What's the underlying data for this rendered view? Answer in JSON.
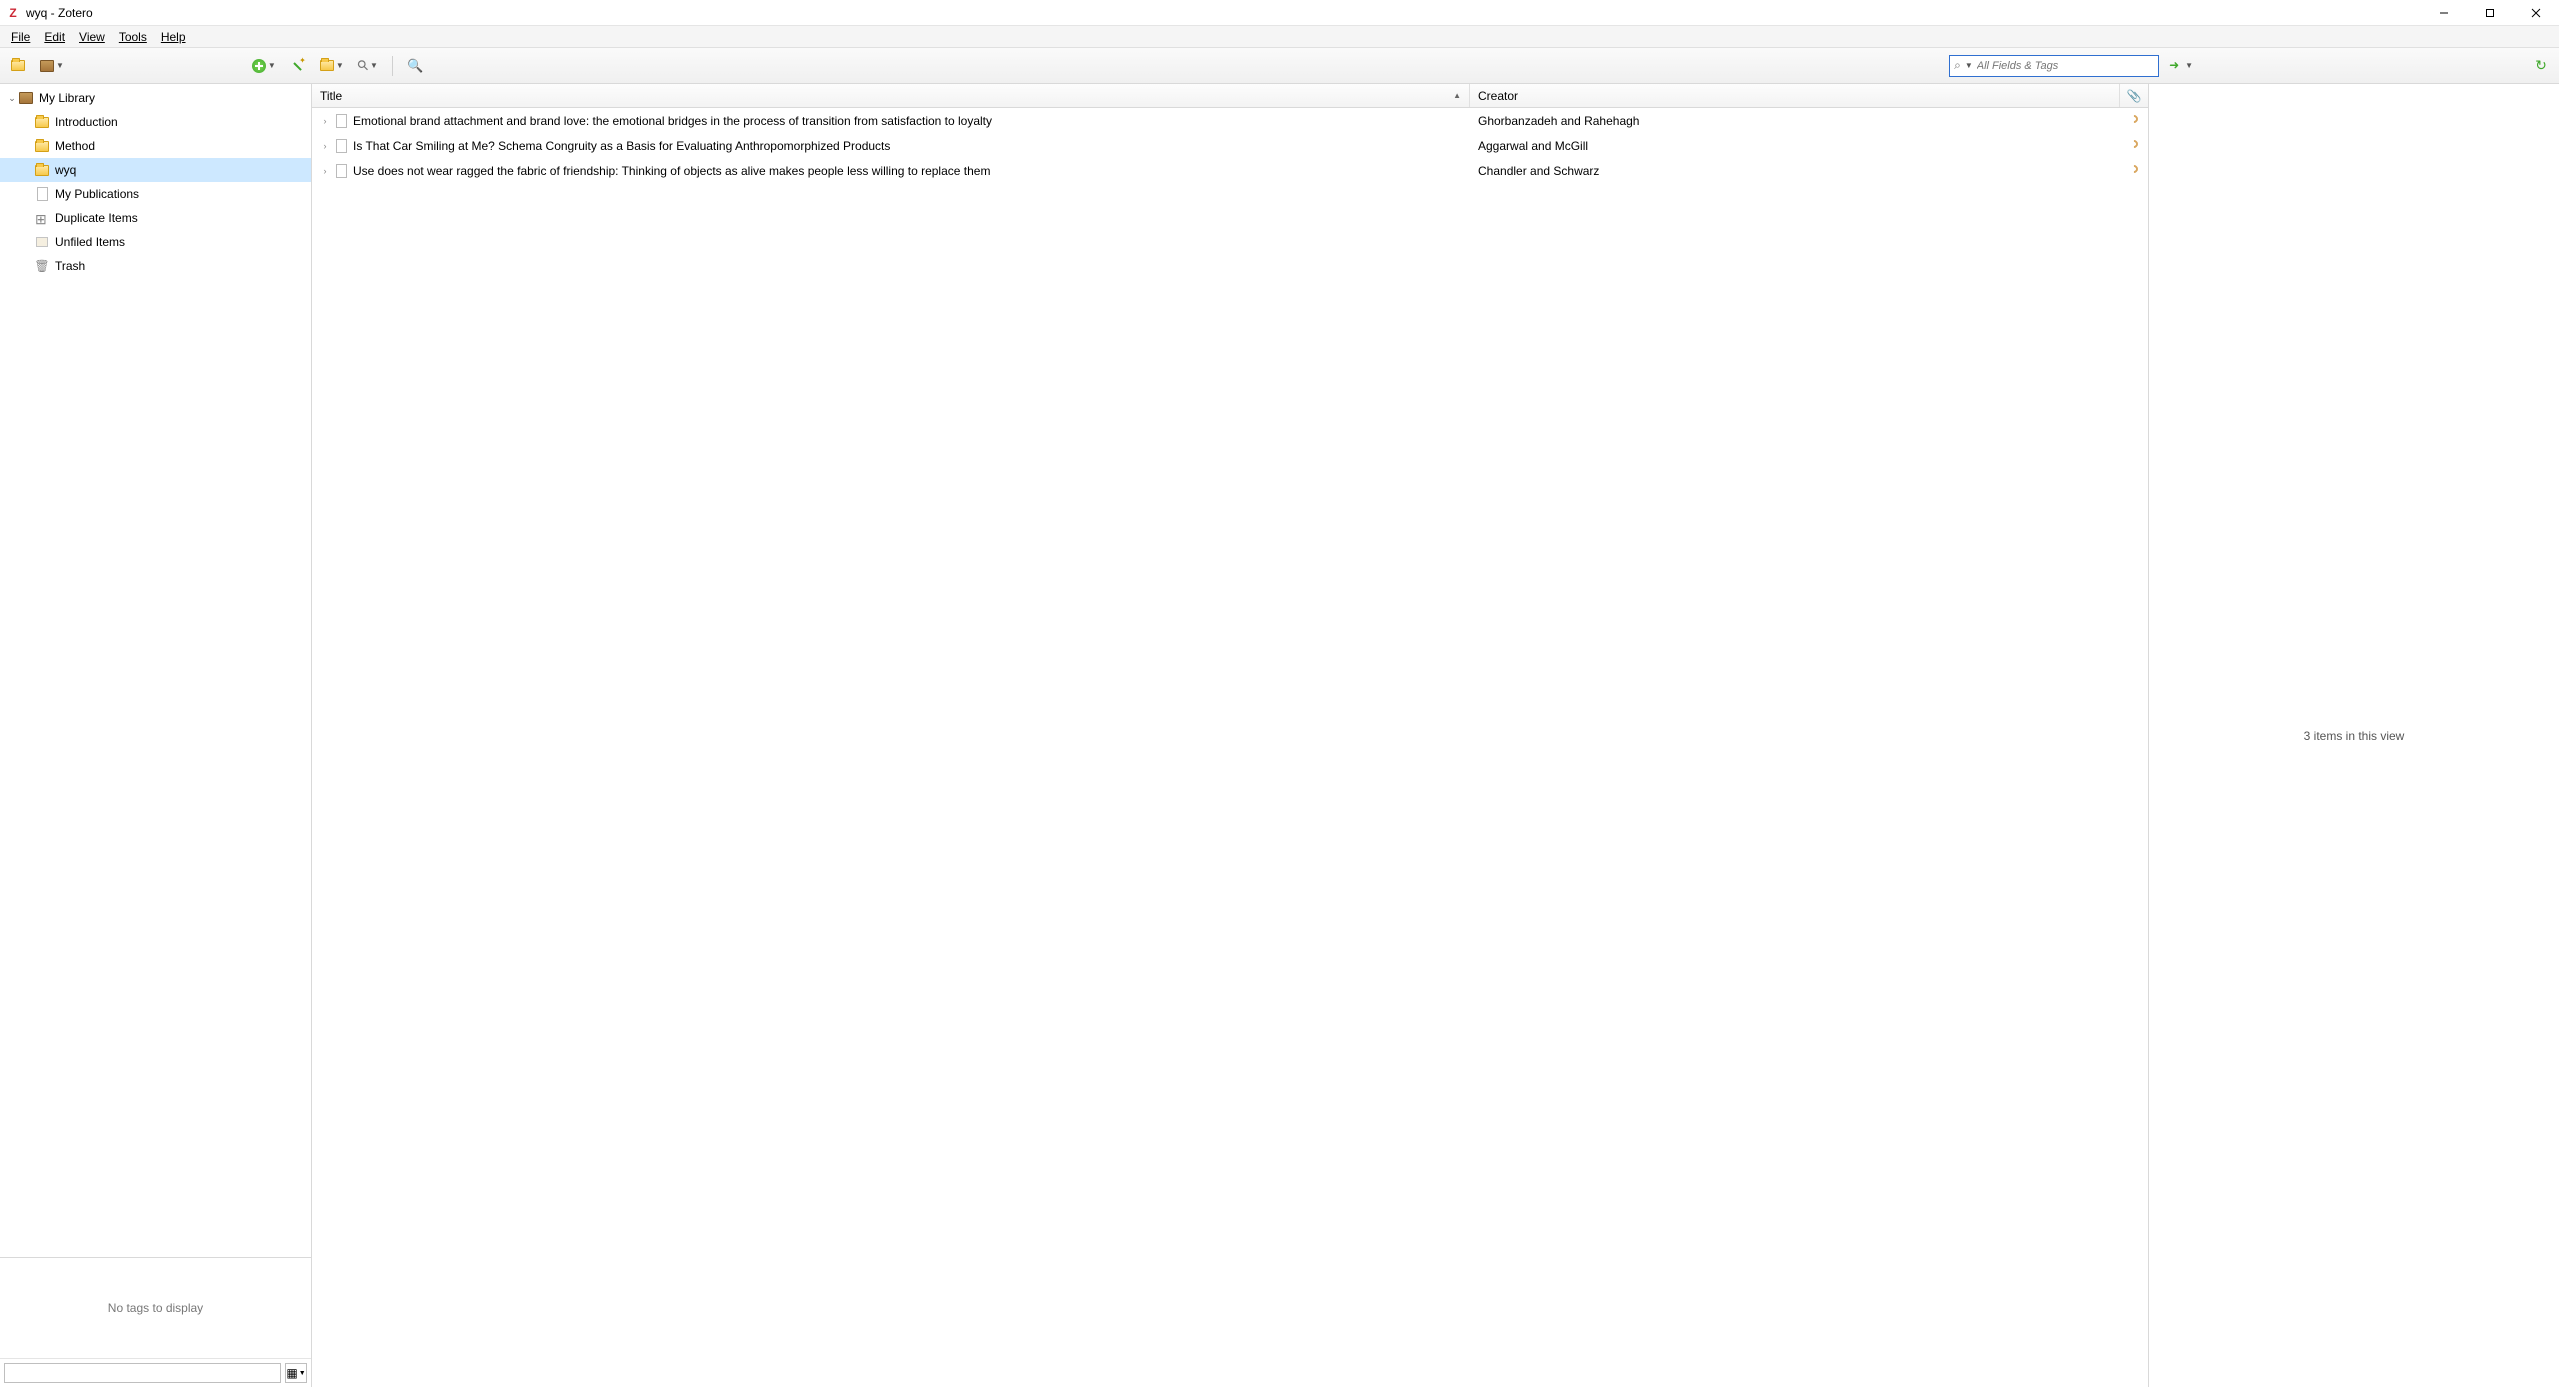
{
  "window": {
    "title": "wyq - Zotero"
  },
  "menubar": {
    "items": [
      "File",
      "Edit",
      "View",
      "Tools",
      "Help"
    ]
  },
  "toolbar": {
    "search_placeholder": "All Fields & Tags"
  },
  "sidebar": {
    "library_label": "My Library",
    "items": [
      {
        "label": "Introduction",
        "type": "folder"
      },
      {
        "label": "Method",
        "type": "folder"
      },
      {
        "label": "wyq",
        "type": "folder",
        "selected": true
      },
      {
        "label": "My Publications",
        "type": "doc"
      },
      {
        "label": "Duplicate Items",
        "type": "dup"
      },
      {
        "label": "Unfiled Items",
        "type": "box"
      },
      {
        "label": "Trash",
        "type": "trash"
      }
    ],
    "tags_empty": "No tags to display"
  },
  "columns": {
    "title": "Title",
    "creator": "Creator"
  },
  "items": [
    {
      "title": "Emotional brand attachment and brand love: the emotional bridges in the process of transition from satisfaction to loyalty",
      "creator": "Ghorbanzadeh and Rahehagh"
    },
    {
      "title": "Is That Car Smiling at Me? Schema Congruity as a Basis for Evaluating Anthropomorphized Products",
      "creator": "Aggarwal and McGill"
    },
    {
      "title": "Use does not wear ragged the fabric of friendship: Thinking of objects as alive makes people less willing to replace them",
      "creator": "Chandler and Schwarz"
    }
  ],
  "rightpane": {
    "status": "3 items in this view"
  }
}
